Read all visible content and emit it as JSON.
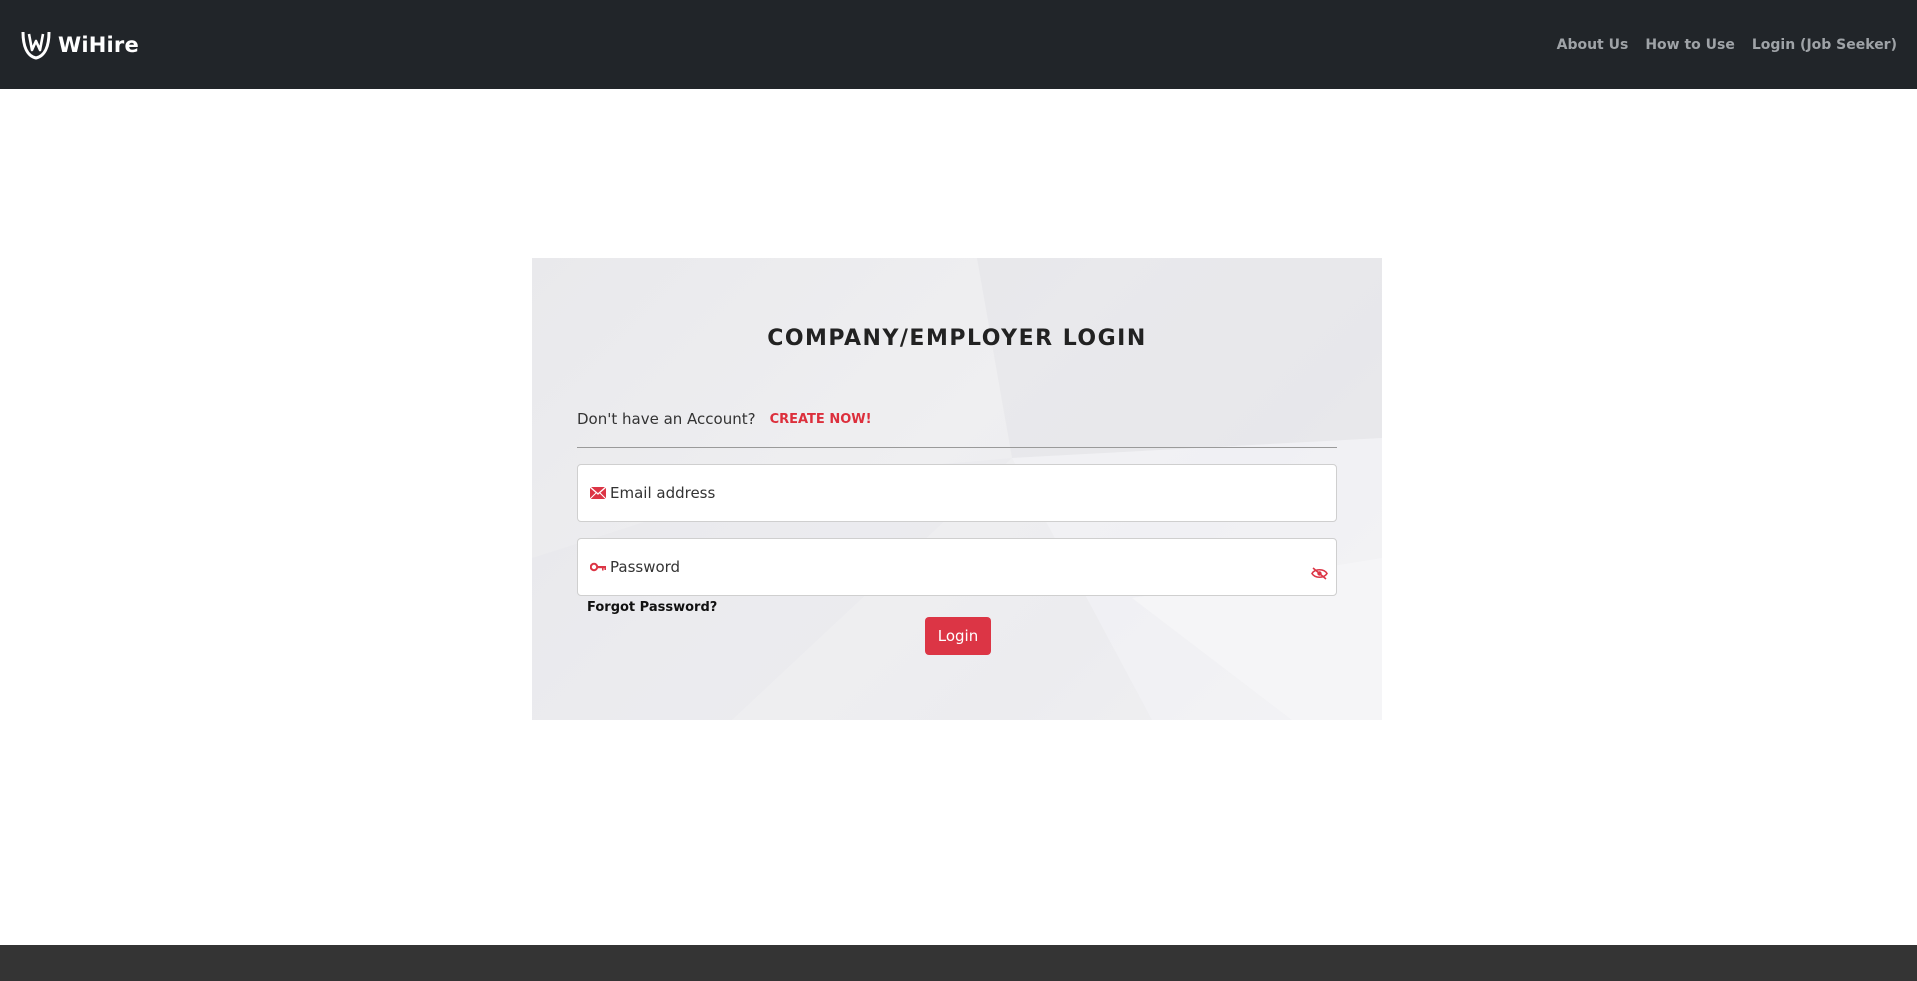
{
  "brand": {
    "name": "WiHire",
    "logo_icon": "wihire-shield-logo"
  },
  "nav": {
    "links": [
      "About Us",
      "How to Use",
      "Login (Job Seeker)"
    ]
  },
  "login_card": {
    "title": "COMPANY/EMPLOYER LOGIN",
    "account_question": "Don't have an Account?",
    "create_link": "CREATE NOW!",
    "email_placeholder": "Email address",
    "password_placeholder": "Password",
    "forgot_label": "Forgot Password?",
    "login_label": "Login"
  },
  "colors": {
    "navbar_bg": "#212529",
    "accent": "#dc3545",
    "link_red": "#dc2f3c",
    "card_bg": "#ececef",
    "footer_bg": "#343434"
  },
  "icons": {
    "email": "envelope-icon",
    "password": "key-icon",
    "toggle": "eye-slash-icon"
  }
}
